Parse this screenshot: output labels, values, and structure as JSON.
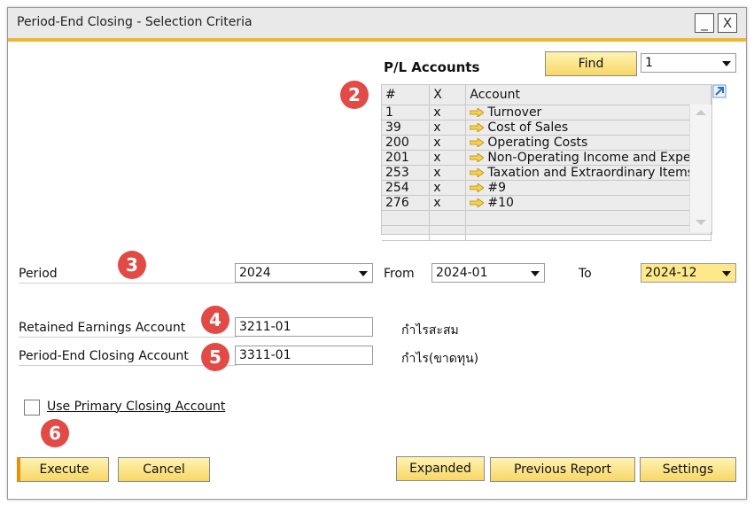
{
  "window": {
    "title": "Period-End Closing - Selection Criteria",
    "minimize": "_",
    "close": "X"
  },
  "pl": {
    "title": "P/L Accounts",
    "find_label": "Find",
    "find_select": "1",
    "columns": [
      "#",
      "X",
      "Account"
    ],
    "rows": [
      {
        "num": "1",
        "x": "x",
        "account": "Turnover"
      },
      {
        "num": "39",
        "x": "x",
        "account": "Cost of Sales"
      },
      {
        "num": "200",
        "x": "x",
        "account": "Operating Costs"
      },
      {
        "num": "201",
        "x": "x",
        "account": "Non-Operating Income and Expen"
      },
      {
        "num": "253",
        "x": "x",
        "account": "Taxation and Extraordinary Items"
      },
      {
        "num": "254",
        "x": "x",
        "account": "#9"
      },
      {
        "num": "276",
        "x": "x",
        "account": "#10"
      }
    ]
  },
  "period": {
    "label": "Period",
    "value": "2024",
    "from_label": "From",
    "from_value": "2024-01",
    "to_label": "To",
    "to_value": "2024-12"
  },
  "retained": {
    "label": "Retained Earnings Account",
    "value": "3211-01",
    "desc": "กำไรสะสม"
  },
  "closing": {
    "label": "Period-End Closing Account",
    "value": "3311-01",
    "desc": "กำไร(ขาดทุน)"
  },
  "primary": {
    "label": "Use Primary Closing Account"
  },
  "badges": [
    "2",
    "3",
    "4",
    "5",
    "6"
  ],
  "buttons": {
    "execute": "Execute",
    "cancel": "Cancel",
    "expanded": "Expanded",
    "previous": "Previous Report",
    "settings": "Settings"
  },
  "colors": {
    "accent": "#f2b531",
    "button_yellow": "#f7d765",
    "badge": "#e24a45",
    "combo_highlight": "#fde98c"
  }
}
